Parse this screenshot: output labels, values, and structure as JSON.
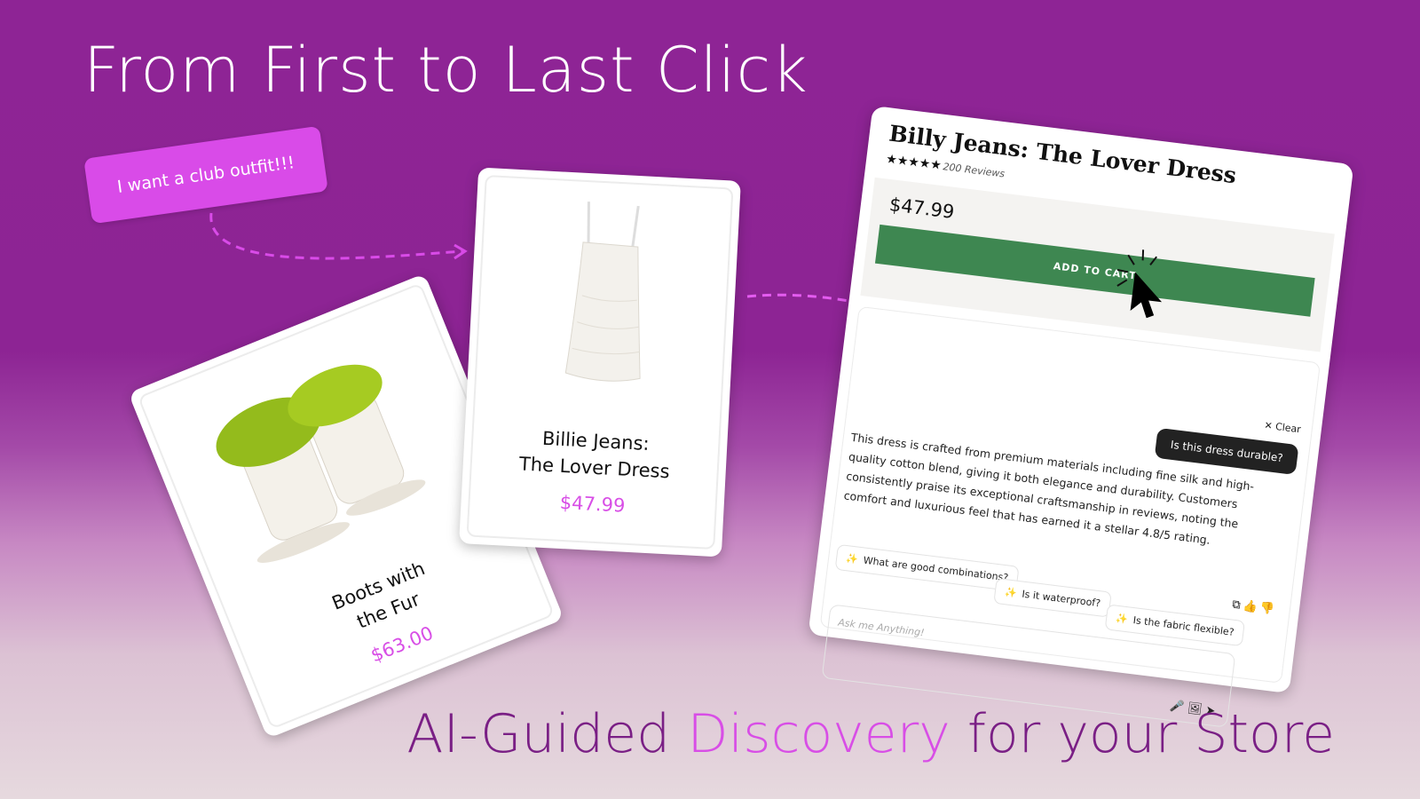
{
  "headline": "From First to Last Click",
  "tagline": {
    "pre": "AI-Guided ",
    "highlight": "Discovery",
    "post": " for your Store"
  },
  "prompt_bubble": "I want a club outfit!!!",
  "cards": {
    "boots": {
      "name_line1": "Boots with",
      "name_line2": "the Fur",
      "price": "$63.00"
    },
    "dress": {
      "name_line1": "Billie Jeans:",
      "name_line2": "The Lover Dress",
      "price": "$47.99"
    }
  },
  "product_page": {
    "title": "Billy Jeans: The Lover Dress",
    "stars": "★★★★★",
    "reviews": "200 Reviews",
    "price": "$47.99",
    "add_to_cart": "ADD TO CART"
  },
  "assistant": {
    "clear_label": "Clear",
    "question": "Is this dress durable?",
    "answer": "This dress is crafted from premium materials including fine silk and high-quality cotton blend, giving it both elegance and durability. Customers consistently praise its exceptional craftsmanship in reviews, noting the comfort and luxurious feel that has earned it a stellar 4.8/5 rating.",
    "suggestions": [
      "What are good combinations?",
      "Is it waterproof?",
      "Is the fabric flexible?"
    ],
    "input_placeholder": "Ask me Anything!"
  },
  "colors": {
    "accent": "#d84ee6",
    "cart_green": "#3e8751",
    "background_top": "#8e2495"
  }
}
